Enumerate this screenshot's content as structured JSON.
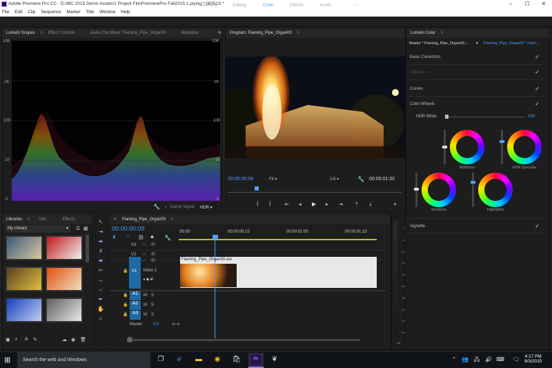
{
  "title_bar": {
    "text": "Adobe Premiere Pro CC - D:\\IBC 2015 Demo Assets\\1 Project File\\PremierePro Fall2015 1.prproj * 08251S *"
  },
  "menu": [
    "File",
    "Edit",
    "Clip",
    "Sequence",
    "Marker",
    "Title",
    "Window",
    "Help"
  ],
  "workspaces": [
    "Assembly",
    "Editing",
    "Color",
    "Effects",
    "Audio"
  ],
  "workspace_active": "Color",
  "scopes_panel": {
    "tabs": [
      "Lumetri Scopes",
      "Effect Controls",
      "Audio Clip Mixer: Flaming_Pipe_Organ00",
      "Metadata"
    ],
    "left_axis": [
      "10K",
      "1K",
      "100",
      "10",
      "0"
    ],
    "right_axis": [
      "10K",
      "1K",
      "100",
      "10",
      "0"
    ],
    "clamp_label": "Clamp Signal",
    "mode": "HDR"
  },
  "program_monitor": {
    "tab": "Program: Flaming_Pipe_Organ00",
    "timecode": "00:00:00:09",
    "fit": "Fit",
    "resolution": "1/4",
    "duration": "00:00:01:20"
  },
  "libraries_panel": {
    "tabs": [
      "Libraries",
      "Info",
      "Effects"
    ],
    "library": "My Library"
  },
  "timeline": {
    "tab": "Flaming_Pipe_Organ00",
    "timecode": "00:00:00:09",
    "ruler": [
      ":00:00",
      "00:00:00:15",
      "00:00:01:00",
      "00:00:01:15"
    ],
    "tracks": [
      "V3",
      "V2",
      "V1",
      "A1",
      "A2",
      "A3"
    ],
    "video1_label": "Video 1",
    "v1_value": "0",
    "clip_name": "Flaming_Pipe_Organ00.exr",
    "master_label": "Master",
    "master_value": "0.0",
    "meter_scale": [
      "0",
      "-6",
      "-12",
      "-18",
      "-24",
      "-30",
      "-36",
      "-42",
      "-48",
      "-54",
      "dB"
    ]
  },
  "lumetri_color": {
    "tab": "Lumetri Color",
    "master_clip": "Master * Flaming_Pipe_Organ00....",
    "sequence_clip": "Flaming_Pipe_Organ00 * Flam...",
    "sections": {
      "basic": "Basic Correction",
      "creative": "Creative",
      "curves": "Curves",
      "wheels": "Color Wheels",
      "vignette": "Vignette"
    },
    "hdr_white_label": "HDR White",
    "hdr_white_value": "100",
    "wheels": [
      "Midtones",
      "HDR Specular",
      "Shadows",
      "Highlights"
    ]
  },
  "taskbar": {
    "search_placeholder": "Search the web and Windows",
    "time": "4:17 PM",
    "date": "9/3/2015"
  }
}
